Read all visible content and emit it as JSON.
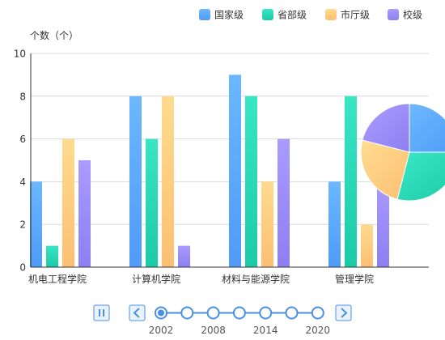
{
  "chart_data": {
    "type": "bar",
    "y_axis_title": "个数（个）",
    "ylim": [
      0,
      10
    ],
    "y_ticks": [
      0,
      2,
      4,
      6,
      8,
      10
    ],
    "grid": true,
    "legend_position": "top-right",
    "categories": [
      "机电工程学院",
      "计算机学院",
      "材料与能源学院",
      "管理学院"
    ],
    "series": [
      {
        "name": "国家级",
        "color": "#4f9bf7",
        "values": [
          4,
          8,
          9,
          4
        ]
      },
      {
        "name": "省部级",
        "color": "#1ccaa8",
        "values": [
          1,
          6,
          8,
          8
        ]
      },
      {
        "name": "市厅级",
        "color": "#fcbf72",
        "values": [
          6,
          8,
          4,
          2
        ]
      },
      {
        "name": "校级",
        "color": "#8d7ff0",
        "values": [
          5,
          1,
          6,
          4
        ]
      }
    ],
    "pie_chart": {
      "type": "pie",
      "slices": [
        {
          "series": "国家级",
          "value": 25
        },
        {
          "series": "省部级",
          "value": 29
        },
        {
          "series": "市厅级",
          "value": 25
        },
        {
          "series": "校级",
          "value": 21
        }
      ]
    }
  },
  "timeline": {
    "points": [
      "2002",
      "2005",
      "2008",
      "2011",
      "2014",
      "2017",
      "2020"
    ],
    "labeled_points": [
      "2002",
      "2008",
      "2014",
      "2020"
    ],
    "current": "2002",
    "play_icon": "pause-icon",
    "prev_icon": "chevron-left-icon",
    "next_icon": "chevron-right-icon"
  },
  "colors": {
    "axis": "#333333",
    "grid": "#d9d9d9",
    "timeline": "#4a90e2"
  }
}
